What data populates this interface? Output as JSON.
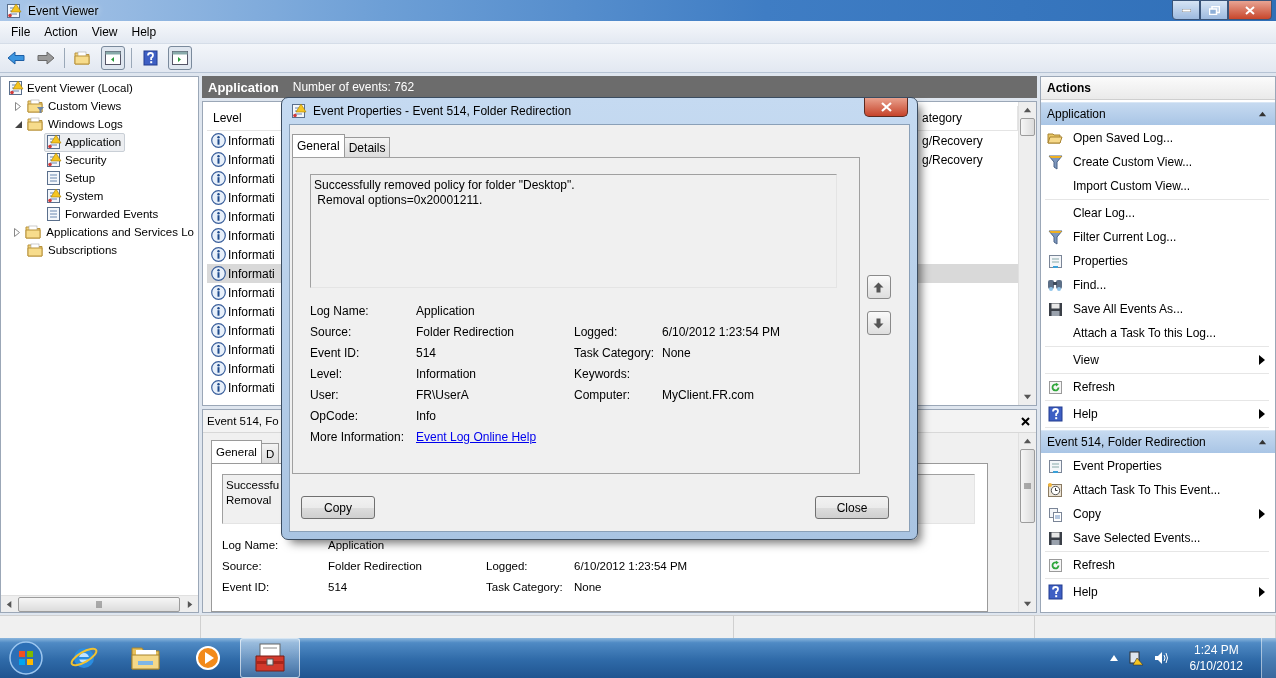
{
  "window": {
    "title": "Event Viewer"
  },
  "menu": [
    "File",
    "Action",
    "View",
    "Help"
  ],
  "tree": [
    {
      "label": "Event Viewer (Local)",
      "kind": "viewer",
      "selected": false,
      "children": [
        {
          "label": "Custom Views",
          "kind": "filterfolder",
          "expanded": false,
          "selected": false
        },
        {
          "label": "Windows Logs",
          "kind": "folder",
          "expanded": true,
          "selected": false,
          "children": [
            {
              "label": "Application",
              "kind": "log",
              "selected": true
            },
            {
              "label": "Security",
              "kind": "log",
              "selected": false
            },
            {
              "label": "Setup",
              "kind": "list",
              "selected": false
            },
            {
              "label": "System",
              "kind": "log",
              "selected": false
            },
            {
              "label": "Forwarded Events",
              "kind": "list",
              "selected": false
            }
          ]
        },
        {
          "label": "Applications and Services Lo",
          "kind": "folder",
          "expanded": false,
          "selected": false
        },
        {
          "label": "Subscriptions",
          "kind": "folder",
          "selected": false
        }
      ]
    }
  ],
  "center": {
    "title": "Application",
    "count": "Number of events: 762"
  },
  "list": {
    "columns": [
      "Level",
      "ategory"
    ],
    "rows": [
      {
        "level": "Informati",
        "category": "g/Recovery",
        "selected": false
      },
      {
        "level": "Informati",
        "category": "g/Recovery",
        "selected": false
      },
      {
        "level": "Informati",
        "selected": false
      },
      {
        "level": "Informati",
        "selected": false
      },
      {
        "level": "Informati",
        "selected": false
      },
      {
        "level": "Informati",
        "selected": false
      },
      {
        "level": "Informati",
        "selected": false
      },
      {
        "level": "Informati",
        "selected": true
      },
      {
        "level": "Informati",
        "selected": false
      },
      {
        "level": "Informati",
        "selected": false
      },
      {
        "level": "Informati",
        "selected": false
      },
      {
        "level": "Informati",
        "selected": false
      },
      {
        "level": "Informati",
        "selected": false
      },
      {
        "level": "Informati",
        "selected": false
      }
    ]
  },
  "preview": {
    "title": "Event 514, Fo",
    "tabs": [
      {
        "label": "General",
        "selected": true
      },
      {
        "label": "D",
        "selected": false
      }
    ],
    "message": [
      "Successfu",
      "Removal"
    ],
    "fields": [
      {
        "label": "Log Name:",
        "value": "Application"
      },
      {
        "label": "Source:",
        "value": "Folder Redirection",
        "label_2": "Logged:",
        "value_2": "6/10/2012 1:23:54 PM"
      },
      {
        "label": "Event ID:",
        "value": "514",
        "label_2": "Task Category:",
        "value_2": "None"
      }
    ]
  },
  "dialog": {
    "title": "Event Properties - Event 514, Folder Redirection",
    "tabs": [
      {
        "label": "General",
        "selected": true
      },
      {
        "label": "Details",
        "selected": false
      }
    ],
    "message": [
      "Successfully removed policy for folder \"Desktop\".",
      "Removal options=0x20001211."
    ],
    "fields": [
      {
        "label": "Log Name:",
        "value": "Application"
      },
      {
        "label": "Source:",
        "value": "Folder Redirection",
        "label_2": "Logged:",
        "value_2": "6/10/2012 1:23:54 PM"
      },
      {
        "label": "Event ID:",
        "value": "514",
        "label_2": "Task Category:",
        "value_2": "None"
      },
      {
        "label": "Level:",
        "value": "Information",
        "label_2": "Keywords:"
      },
      {
        "label": "User:",
        "value": "FR\\UserA",
        "label_2": "Computer:",
        "value_2": "MyClient.FR.com"
      },
      {
        "label": "OpCode:",
        "value": "Info"
      }
    ],
    "more_label": "More Information:",
    "link": "Event Log Online Help",
    "buttons": [
      "Copy",
      "Close"
    ]
  },
  "actions": {
    "title": "Actions",
    "sections": [
      {
        "title": "Application",
        "expanded": true,
        "groups": [
          [
            {
              "label": "Open Saved Log...",
              "kind": "open",
              "submenu": false
            },
            {
              "label": "Create Custom View...",
              "kind": "funnel",
              "submenu": false
            },
            {
              "label": "Import Custom View...",
              "kind": "plain",
              "submenu": false
            }
          ],
          [
            {
              "label": "Clear Log...",
              "kind": "plain",
              "submenu": false
            },
            {
              "label": "Filter Current Log...",
              "kind": "funnel",
              "submenu": false
            },
            {
              "label": "Properties",
              "kind": "sheet",
              "submenu": false
            },
            {
              "label": "Find...",
              "kind": "binoculars",
              "submenu": false
            },
            {
              "label": "Save All Events As...",
              "kind": "disk",
              "submenu": false
            },
            {
              "label": "Attach a Task To this Log...",
              "kind": "plain",
              "submenu": false
            }
          ],
          [
            {
              "label": "View",
              "kind": "plain",
              "submenu": true
            }
          ],
          [
            {
              "label": "Refresh",
              "kind": "refresh",
              "submenu": false
            }
          ],
          [
            {
              "label": "Help",
              "kind": "help",
              "submenu": true
            }
          ]
        ]
      },
      {
        "title": "Event 514, Folder Redirection",
        "expanded": true,
        "groups": [
          [
            {
              "label": "Event Properties",
              "kind": "sheet",
              "submenu": false
            },
            {
              "label": "Attach Task To This Event...",
              "kind": "clock",
              "submenu": false
            },
            {
              "label": "Copy",
              "kind": "copy",
              "submenu": true
            },
            {
              "label": "Save Selected Events...",
              "kind": "disk",
              "submenu": false
            }
          ],
          [
            {
              "label": "Refresh",
              "kind": "refresh",
              "submenu": false
            }
          ],
          [
            {
              "label": "Help",
              "kind": "help",
              "submenu": true
            }
          ]
        ]
      }
    ]
  },
  "taskbar": {
    "apps": [
      {
        "kind": "browser",
        "selected": false
      },
      {
        "kind": "folder",
        "selected": false
      },
      {
        "kind": "media",
        "selected": false
      },
      {
        "kind": "toolbox",
        "selected": true
      }
    ],
    "time": "1:24 PM",
    "date": "6/10/2012"
  }
}
